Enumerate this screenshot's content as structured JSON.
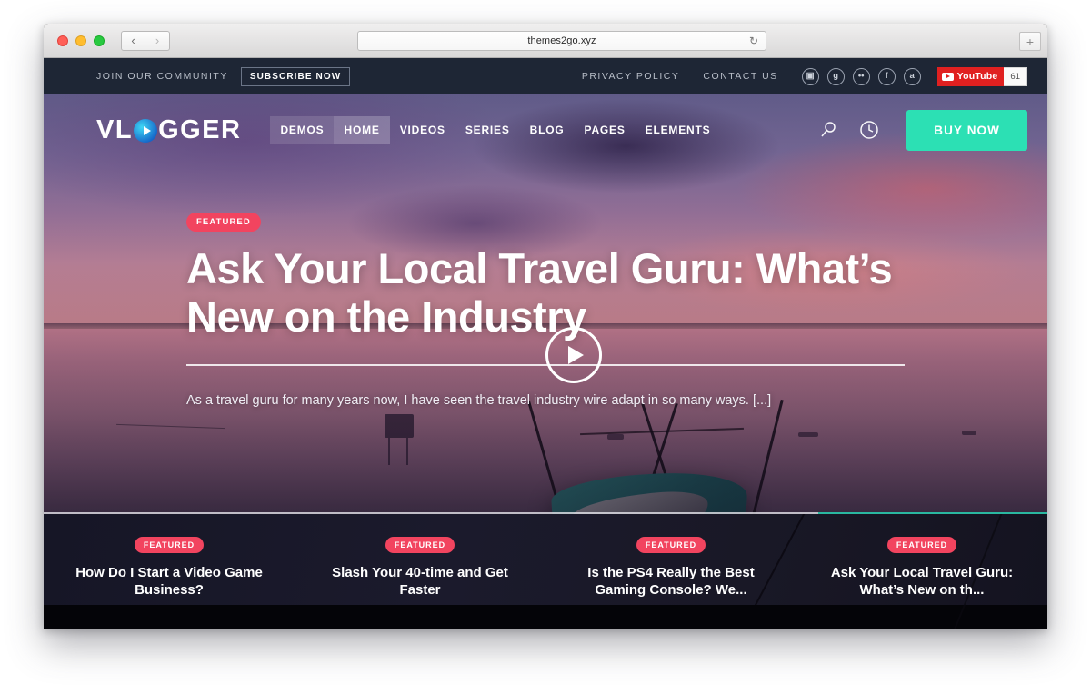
{
  "browser": {
    "url": "themes2go.xyz",
    "back_label": "‹",
    "forward_label": "›",
    "reload_label": "↻",
    "newtab_label": "+"
  },
  "topbar": {
    "join_label": "JOIN OUR COMMUNITY",
    "subscribe_label": "SUBSCRIBE NOW",
    "links": [
      {
        "label": "PRIVACY POLICY"
      },
      {
        "label": "CONTACT US"
      }
    ],
    "socials": [
      {
        "name": "instagram-icon",
        "glyph": "▣"
      },
      {
        "name": "google-plus-icon",
        "glyph": "g"
      },
      {
        "name": "flickr-icon",
        "glyph": "••"
      },
      {
        "name": "facebook-icon",
        "glyph": "f"
      },
      {
        "name": "amazon-icon",
        "glyph": "a"
      }
    ],
    "youtube": {
      "label": "YouTube",
      "count": "61"
    }
  },
  "header": {
    "logo": {
      "pre": "VL",
      "post": "GGER"
    },
    "nav": [
      {
        "label": "DEMOS",
        "state": "grouped"
      },
      {
        "label": "HOME",
        "state": "active"
      },
      {
        "label": "VIDEOS",
        "state": "normal"
      },
      {
        "label": "SERIES",
        "state": "normal"
      },
      {
        "label": "BLOG",
        "state": "normal"
      },
      {
        "label": "PAGES",
        "state": "normal"
      },
      {
        "label": "ELEMENTS",
        "state": "normal"
      }
    ],
    "buy_now_label": "BUY NOW"
  },
  "hero": {
    "badge": "FEATURED",
    "title": "Ask Your Local Travel Guru: What’s New on the Industry",
    "excerpt": "As a travel guru for many years now, I have seen the travel industry wire adapt in so many ways. [...]",
    "progress_percent": 23
  },
  "carousel": {
    "cards": [
      {
        "badge": "FEATURED",
        "title": "How Do I Start a Video Game Business?"
      },
      {
        "badge": "FEATURED",
        "title": "Slash Your 40-time and Get Faster"
      },
      {
        "badge": "FEATURED",
        "title": "Is the PS4 Really the Best Gaming Console? We..."
      },
      {
        "badge": "FEATURED",
        "title": "Ask Your Local Travel Guru: What’s New on th..."
      }
    ]
  },
  "colors": {
    "accent_pink": "#f2445f",
    "accent_teal": "#2ce0b4",
    "progress_teal": "#2ab7a0",
    "topbar_bg": "#1e2635",
    "youtube_red": "#e02020"
  }
}
